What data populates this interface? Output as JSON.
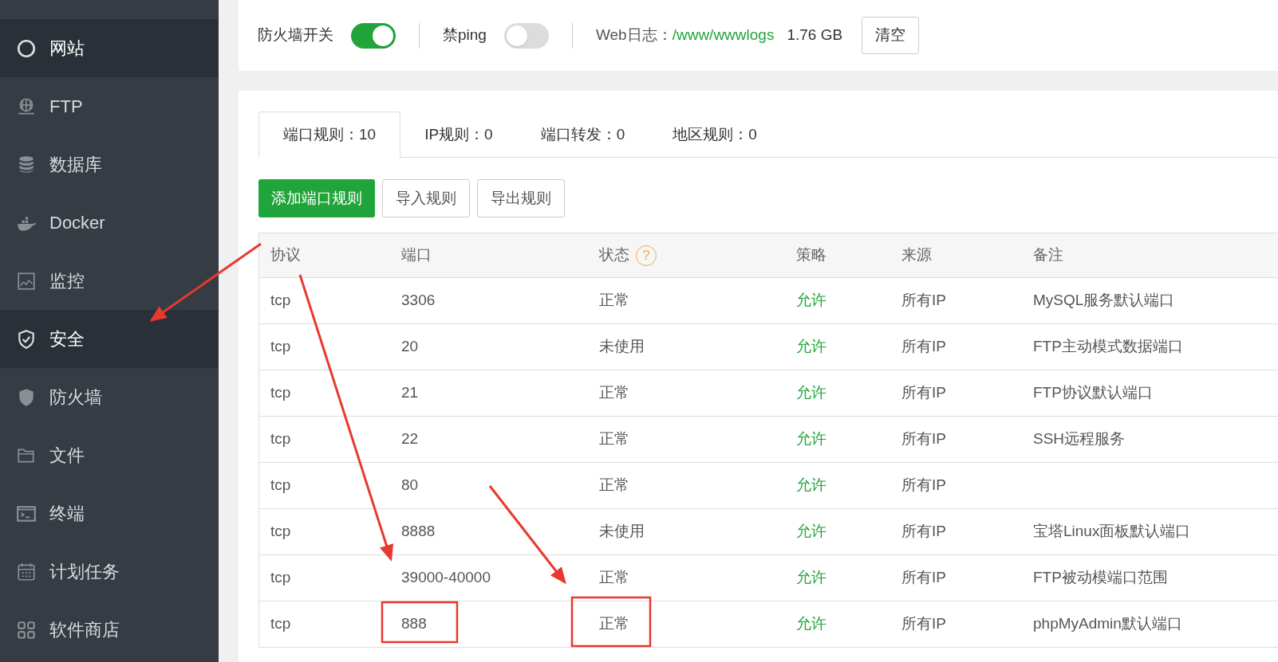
{
  "sidebar": {
    "items": [
      {
        "label": "网站",
        "selected": true
      },
      {
        "label": "FTP",
        "selected": false
      },
      {
        "label": "数据库",
        "selected": false
      },
      {
        "label": "Docker",
        "selected": false
      },
      {
        "label": "监控",
        "selected": false
      },
      {
        "label": "安全",
        "selected": true
      },
      {
        "label": "防火墙",
        "selected": false
      },
      {
        "label": "文件",
        "selected": false
      },
      {
        "label": "终端",
        "selected": false
      },
      {
        "label": "计划任务",
        "selected": false
      },
      {
        "label": "软件商店",
        "selected": false
      }
    ]
  },
  "top_bar": {
    "firewall_switch": {
      "label": "防火墙开关",
      "on": true
    },
    "ping_switch": {
      "label": "禁ping",
      "on": false
    },
    "web_log": {
      "label": "Web日志：",
      "path": "/www/wwwlogs",
      "size": "1.76 GB",
      "clear_button": "清空"
    }
  },
  "tabs": [
    {
      "label": "端口规则：10",
      "selected": true
    },
    {
      "label": "IP规则：0",
      "selected": false
    },
    {
      "label": "端口转发：0",
      "selected": false
    },
    {
      "label": "地区规则：0",
      "selected": false
    }
  ],
  "actions": [
    {
      "label": "添加端口规则",
      "kind": "primary"
    },
    {
      "label": "导入规则",
      "kind": "default"
    },
    {
      "label": "导出规则",
      "kind": "default"
    }
  ],
  "table": {
    "columns": [
      "协议",
      "端口",
      "状态",
      "策略",
      "来源",
      "备注"
    ],
    "status_help": "?",
    "rows": [
      [
        "tcp",
        "3306",
        "正常",
        "允许",
        "所有IP",
        "MySQL服务默认端口"
      ],
      [
        "tcp",
        "20",
        "未使用",
        "允许",
        "所有IP",
        "FTP主动模式数据端口"
      ],
      [
        "tcp",
        "21",
        "正常",
        "允许",
        "所有IP",
        "FTP协议默认端口"
      ],
      [
        "tcp",
        "22",
        "正常",
        "允许",
        "所有IP",
        "SSH远程服务"
      ],
      [
        "tcp",
        "80",
        "正常",
        "允许",
        "所有IP",
        ""
      ],
      [
        "tcp",
        "8888",
        "未使用",
        "允许",
        "所有IP",
        "宝塔Linux面板默认端口"
      ],
      [
        "tcp",
        "39000-40000",
        "正常",
        "允许",
        "所有IP",
        "FTP被动模端口范围"
      ],
      [
        "tcp",
        "888",
        "正常",
        "允许",
        "所有IP",
        "phpMyAdmin默认端口"
      ]
    ]
  }
}
